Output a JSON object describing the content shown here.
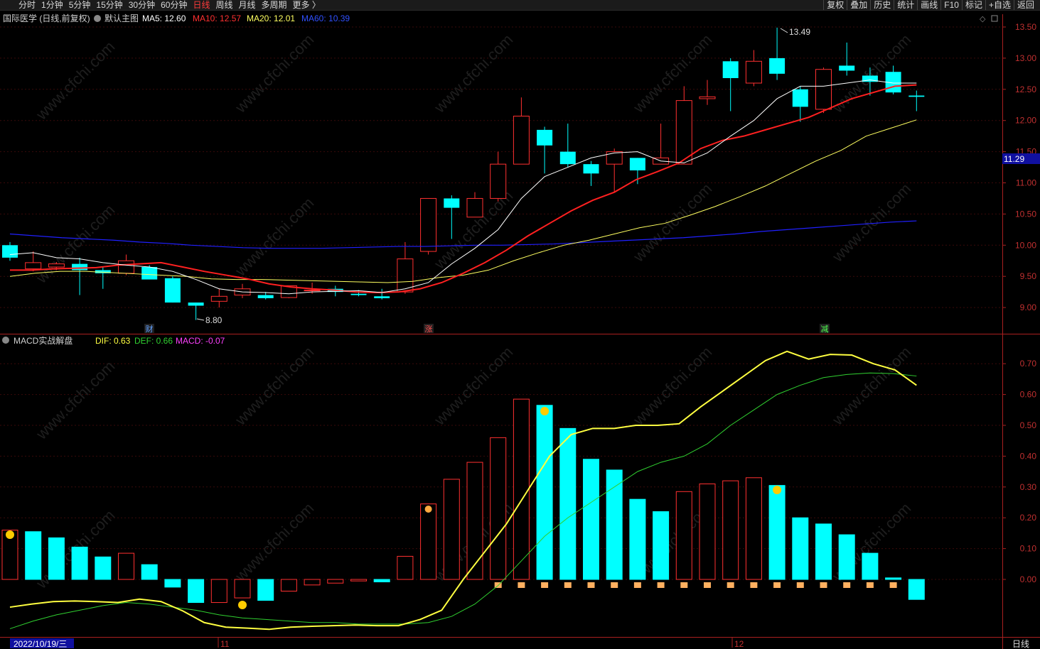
{
  "toolbar": {
    "periods": [
      "分时",
      "1分钟",
      "5分钟",
      "15分钟",
      "30分钟",
      "60分钟",
      "日线",
      "周线",
      "月线",
      "多周期",
      "更多 〉"
    ],
    "active_period": "日线",
    "right_buttons": [
      "复权",
      "叠加",
      "历史",
      "统计",
      "画线",
      "F10",
      "标记",
      "+自选",
      "返回"
    ]
  },
  "main_panel": {
    "title": "国际医学 (日线,前复权)",
    "indicator_name": "默认主图",
    "ma5_label": "MA5: 12.60",
    "ma10_label": "MA10: 12.57",
    "ma20_label": "MA20: 12.01",
    "ma60_label": "MA60: 10.39",
    "high_label": "13.49",
    "low_label": "8.80",
    "current_price": "11.29",
    "markers": [
      "财",
      "涨",
      "减"
    ],
    "y_ticks": [
      "13.50",
      "13.00",
      "12.50",
      "12.00",
      "11.50",
      "11.00",
      "10.50",
      "10.00",
      "9.50",
      "9.00"
    ]
  },
  "macd_panel": {
    "name": "MACD实战解盘",
    "dif_label": "DIF: 0.63",
    "def_label": "DEF: 0.66",
    "macd_label": "MACD: -0.07",
    "y_ticks": [
      "0.70",
      "0.60",
      "0.50",
      "0.40",
      "0.30",
      "0.20",
      "0.10",
      "0.00"
    ]
  },
  "bottom_axis": {
    "date_label": "2022/10/19/三",
    "month_labels": [
      "11",
      "12"
    ],
    "period_label": "日线"
  },
  "watermark": "www.cfchi.com",
  "colors": {
    "up": "#ff3030",
    "down": "#00ffff",
    "ma5": "#ffffff",
    "ma10": "#ff2020",
    "ma20": "#ffff60",
    "ma60": "#2020ff",
    "dif": "#ffff40",
    "def": "#30d030",
    "macd": "#ff40ff",
    "axis": "#aa2020"
  },
  "chart_data": [
    {
      "type": "candlestick",
      "y_range": [
        8.7,
        13.6
      ],
      "candles": [
        {
          "o": 10.0,
          "h": 10.05,
          "l": 9.75,
          "c": 9.8
        },
        {
          "o": 9.62,
          "h": 9.9,
          "l": 9.58,
          "c": 9.72
        },
        {
          "o": 9.65,
          "h": 9.73,
          "l": 9.6,
          "c": 9.7
        },
        {
          "o": 9.7,
          "h": 9.8,
          "l": 9.2,
          "c": 9.6
        },
        {
          "o": 9.6,
          "h": 9.65,
          "l": 9.3,
          "c": 9.55
        },
        {
          "o": 9.55,
          "h": 9.85,
          "l": 9.52,
          "c": 9.75
        },
        {
          "o": 9.65,
          "h": 9.68,
          "l": 9.48,
          "c": 9.45
        },
        {
          "o": 9.47,
          "h": 9.5,
          "l": 9.08,
          "c": 9.08
        },
        {
          "o": 9.08,
          "h": 9.08,
          "l": 8.8,
          "c": 9.03
        },
        {
          "o": 9.1,
          "h": 9.3,
          "l": 9.0,
          "c": 9.18
        },
        {
          "o": 9.2,
          "h": 9.38,
          "l": 9.15,
          "c": 9.3
        },
        {
          "o": 9.2,
          "h": 9.25,
          "l": 9.13,
          "c": 9.15
        },
        {
          "o": 9.16,
          "h": 9.35,
          "l": 9.15,
          "c": 9.35
        },
        {
          "o": 9.28,
          "h": 9.4,
          "l": 9.22,
          "c": 9.28
        },
        {
          "o": 9.3,
          "h": 9.35,
          "l": 9.18,
          "c": 9.25
        },
        {
          "o": 9.22,
          "h": 9.28,
          "l": 9.18,
          "c": 9.2
        },
        {
          "o": 9.18,
          "h": 9.3,
          "l": 9.13,
          "c": 9.15
        },
        {
          "o": 9.25,
          "h": 10.05,
          "l": 9.22,
          "c": 9.78
        },
        {
          "o": 9.9,
          "h": 10.75,
          "l": 9.85,
          "c": 10.75
        },
        {
          "o": 10.75,
          "h": 10.8,
          "l": 10.1,
          "c": 10.6
        },
        {
          "o": 10.45,
          "h": 10.85,
          "l": 10.45,
          "c": 10.75
        },
        {
          "o": 10.75,
          "h": 11.5,
          "l": 10.7,
          "c": 11.3
        },
        {
          "o": 11.3,
          "h": 12.37,
          "l": 11.3,
          "c": 12.07
        },
        {
          "o": 11.85,
          "h": 11.9,
          "l": 11.15,
          "c": 11.6
        },
        {
          "o": 11.5,
          "h": 11.95,
          "l": 11.25,
          "c": 11.3
        },
        {
          "o": 11.3,
          "h": 11.35,
          "l": 10.95,
          "c": 11.15
        },
        {
          "o": 11.3,
          "h": 11.55,
          "l": 10.85,
          "c": 11.5
        },
        {
          "o": 11.4,
          "h": 11.4,
          "l": 10.98,
          "c": 11.2
        },
        {
          "o": 11.3,
          "h": 11.95,
          "l": 11.3,
          "c": 11.4
        },
        {
          "o": 11.3,
          "h": 12.55,
          "l": 11.3,
          "c": 12.32
        },
        {
          "o": 12.35,
          "h": 12.65,
          "l": 12.25,
          "c": 12.38
        },
        {
          "o": 12.95,
          "h": 13.0,
          "l": 12.15,
          "c": 12.68
        },
        {
          "o": 12.6,
          "h": 13.13,
          "l": 12.55,
          "c": 12.95
        },
        {
          "o": 13.0,
          "h": 13.49,
          "l": 12.65,
          "c": 12.75
        },
        {
          "o": 12.5,
          "h": 12.55,
          "l": 11.98,
          "c": 12.22
        },
        {
          "o": 12.18,
          "h": 12.85,
          "l": 12.12,
          "c": 12.82
        },
        {
          "o": 12.88,
          "h": 13.25,
          "l": 12.72,
          "c": 12.8
        },
        {
          "o": 12.72,
          "h": 12.85,
          "l": 12.4,
          "c": 12.62
        },
        {
          "o": 12.78,
          "h": 12.88,
          "l": 12.42,
          "c": 12.45
        },
        {
          "o": 12.4,
          "h": 12.48,
          "l": 12.15,
          "c": 12.38
        }
      ],
      "ma5": [
        9.85,
        9.88,
        9.8,
        9.78,
        9.72,
        9.68,
        9.65,
        9.58,
        9.45,
        9.3,
        9.25,
        9.24,
        9.22,
        9.25,
        9.26,
        9.27,
        9.24,
        9.3,
        9.4,
        9.7,
        9.95,
        10.25,
        10.75,
        11.1,
        11.25,
        11.4,
        11.48,
        11.5,
        11.35,
        11.32,
        11.48,
        11.75,
        12.0,
        12.35,
        12.55,
        12.55,
        12.6,
        12.65,
        12.6,
        12.6
      ],
      "ma10": [
        9.6,
        9.6,
        9.62,
        9.63,
        9.64,
        9.68,
        9.7,
        9.72,
        9.65,
        9.58,
        9.52,
        9.46,
        9.38,
        9.33,
        9.3,
        9.28,
        9.25,
        9.24,
        9.25,
        9.3,
        9.4,
        9.55,
        9.72,
        9.92,
        10.15,
        10.35,
        10.55,
        10.72,
        10.85,
        11.05,
        11.18,
        11.32,
        11.55,
        11.68,
        11.75,
        11.85,
        11.95,
        12.05,
        12.2,
        12.35,
        12.45,
        12.55,
        12.57
      ],
      "ma20": [
        9.5,
        9.55,
        9.58,
        9.58,
        9.56,
        9.54,
        9.52,
        9.5,
        9.46,
        9.45,
        9.45,
        9.44,
        9.43,
        9.42,
        9.41,
        9.4,
        9.42,
        9.48,
        9.52,
        9.6,
        9.75,
        9.88,
        10.0,
        10.08,
        10.18,
        10.28,
        10.35,
        10.48,
        10.62,
        10.78,
        10.95,
        11.15,
        11.35,
        11.52,
        11.75,
        11.88,
        12.01
      ],
      "ma60": [
        10.18,
        10.15,
        10.12,
        10.1,
        10.08,
        10.05,
        10.03,
        10.0,
        9.98,
        9.96,
        9.95,
        9.95,
        9.95,
        9.96,
        9.97,
        9.98,
        9.98,
        9.99,
        10.0,
        10.0,
        10.01,
        10.02,
        10.04,
        10.06,
        10.08,
        10.1,
        10.12,
        10.15,
        10.18,
        10.22,
        10.25,
        10.28,
        10.31,
        10.34,
        10.37,
        10.39
      ]
    },
    {
      "type": "bar",
      "y_range": [
        -0.14,
        0.78
      ],
      "macd": [
        0.16,
        0.155,
        0.135,
        0.105,
        0.073,
        0.085,
        0.048,
        -0.025,
        -0.075,
        -0.075,
        -0.06,
        -0.068,
        -0.038,
        -0.018,
        -0.012,
        -0.005,
        -0.008,
        0.075,
        0.245,
        0.325,
        0.38,
        0.46,
        0.585,
        0.565,
        0.49,
        0.39,
        0.355,
        0.26,
        0.22,
        0.285,
        0.31,
        0.32,
        0.33,
        0.305,
        0.2,
        0.18,
        0.145,
        0.085,
        0.005,
        -0.065
      ],
      "dif": [
        -0.09,
        -0.08,
        -0.072,
        -0.07,
        -0.072,
        -0.075,
        -0.064,
        -0.072,
        -0.102,
        -0.14,
        -0.155,
        -0.158,
        -0.162,
        -0.155,
        -0.152,
        -0.15,
        -0.148,
        -0.15,
        -0.15,
        -0.13,
        -0.1,
        0.0,
        0.09,
        0.18,
        0.29,
        0.4,
        0.47,
        0.49,
        0.49,
        0.5,
        0.5,
        0.505,
        0.56,
        0.61,
        0.66,
        0.71,
        0.74,
        0.715,
        0.73,
        0.728,
        0.7,
        0.68,
        0.63
      ],
      "def": [
        -0.16,
        -0.135,
        -0.115,
        -0.1,
        -0.085,
        -0.075,
        -0.08,
        -0.09,
        -0.1,
        -0.115,
        -0.125,
        -0.13,
        -0.135,
        -0.14,
        -0.14,
        -0.145,
        -0.145,
        -0.145,
        -0.14,
        -0.12,
        -0.08,
        -0.02,
        0.06,
        0.14,
        0.2,
        0.25,
        0.3,
        0.35,
        0.38,
        0.4,
        0.44,
        0.5,
        0.55,
        0.6,
        0.63,
        0.655,
        0.665,
        0.67,
        0.668,
        0.66
      ]
    }
  ]
}
